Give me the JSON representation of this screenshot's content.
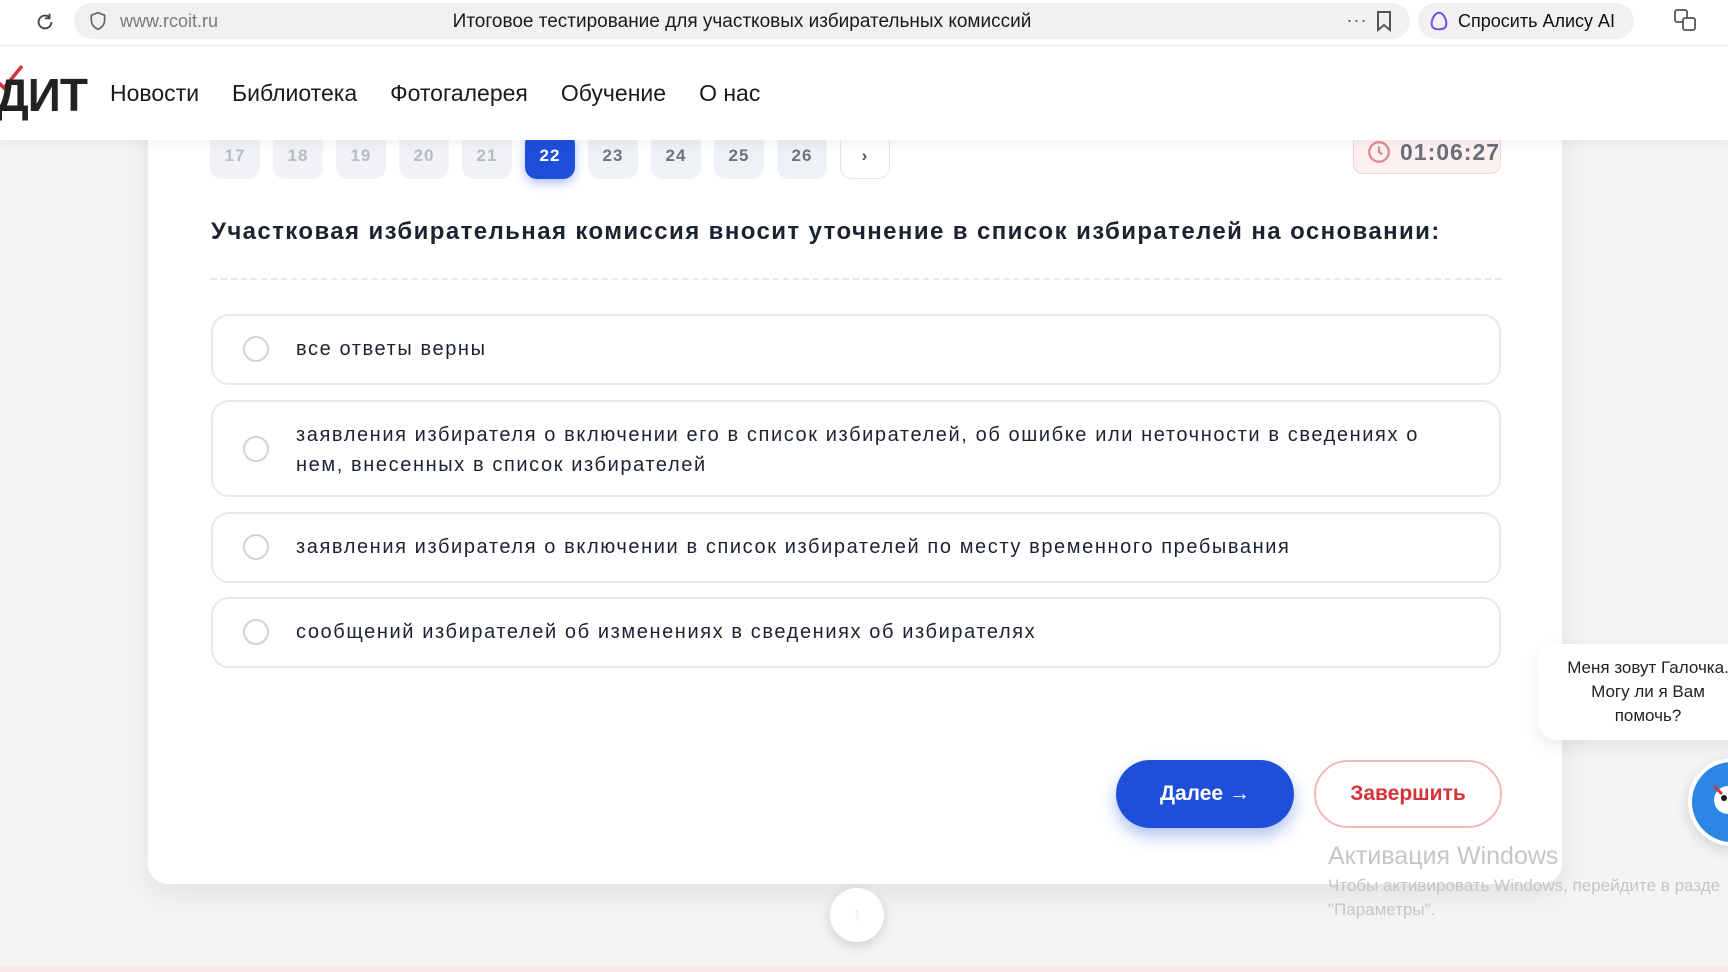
{
  "browser": {
    "url": "www.rcoit.ru",
    "tab_title": "Итоговое тестирование для участковых избирательных комиссий",
    "more": "···",
    "alice_label": "Спросить Алису AI"
  },
  "site": {
    "logo": "ДИТ",
    "nav": [
      "Новости",
      "Библиотека",
      "Фотогалерея",
      "Обучение",
      "О нас"
    ]
  },
  "quiz": {
    "pages": [
      "17",
      "18",
      "19",
      "20",
      "21",
      "22",
      "23",
      "24",
      "25",
      "26"
    ],
    "active_page": "22",
    "next_page": "›",
    "timer": "01:06:27",
    "question": "Участковая избирательная комиссия вносит уточнение в список избирателей на основании:",
    "options": [
      "все ответы верны",
      "заявления избирателя о включении его в список избирателей, об ошибке или неточности в сведениях о нем, внесенных в список избирателей",
      "заявления избирателя о включении в список избирателей по месту временного пребывания",
      "сообщений избирателей об изменениях в сведениях об избирателях"
    ],
    "next_button": "Далее →",
    "finish_button": "Завершить"
  },
  "chatbot": {
    "line1": "Меня зовут Галочка.",
    "line2": "Могу ли я Вам",
    "line3": "помочь?"
  },
  "windows": {
    "title": "Активация Windows",
    "line1": "Чтобы активировать Windows, перейдите в разде",
    "line2": "\"Параметры\"."
  },
  "scroll_up": "↑",
  "colors": {
    "accent": "#1f4fd9",
    "danger": "#d3343a"
  }
}
